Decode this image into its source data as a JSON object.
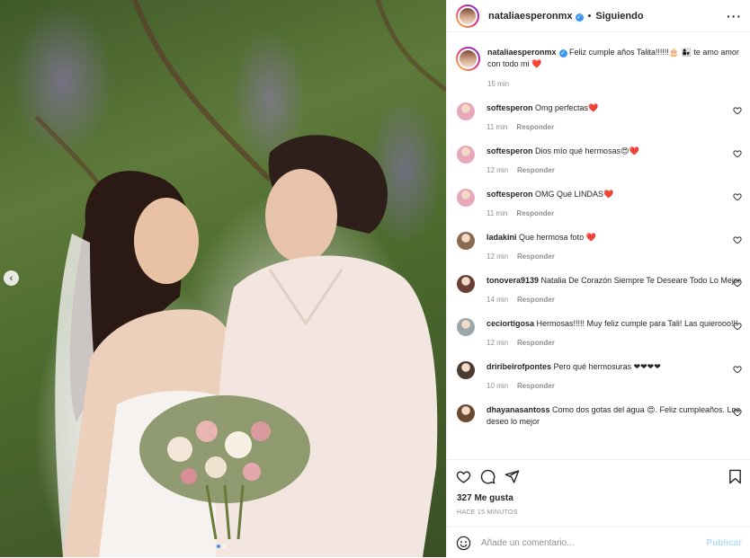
{
  "post": {
    "author": "nataliaesperonmx",
    "follow_label": "Siguiendo",
    "more_label": "···",
    "caption_text": "Feliz cumple años Talita!!!!!!🎂 👩‍👧 te amo amor con todo mi ❤️",
    "caption_time": "15 min",
    "likes": "327 Me gusta",
    "time_ago": "HACE 15 MINUTOS"
  },
  "comments": [
    {
      "user": "softesperon",
      "text": "Omg perfectas❤️",
      "time": "11 min",
      "reply": "Responder",
      "avatar_color": "#e7a9b8"
    },
    {
      "user": "softesperon",
      "text": "Dios mío qué hermosas😍❤️",
      "time": "12 min",
      "reply": "Responder",
      "avatar_color": "#e7a9b8"
    },
    {
      "user": "softesperon",
      "text": "OMG Qué LINDAS❤️",
      "time": "11 min",
      "reply": "Responder",
      "avatar_color": "#e7a9b8"
    },
    {
      "user": "ladakini",
      "text": "Que hermosa foto ❤️",
      "time": "12 min",
      "reply": "Responder",
      "avatar_color": "#8a6a50"
    },
    {
      "user": "tonovera9139",
      "text": "Natalia De Corazón Siempre Te Deseare Todo Lo Mejor",
      "time": "14 min",
      "reply": "Responder",
      "avatar_color": "#6b3e36"
    },
    {
      "user": "ceciortigosa",
      "text": "Hermosas!!!!! Muy feliz cumple para Tali! Las quierooo!!!",
      "time": "12 min",
      "reply": "Responder",
      "avatar_color": "#9aa6a8"
    },
    {
      "user": "driribeirofpontes",
      "text": "Pero qué hermosuras ❤❤❤❤",
      "time": "10 min",
      "reply": "Responder",
      "avatar_color": "#4a3a30"
    },
    {
      "user": "dhayanasantoss",
      "text": "Como dos gotas del água 😍. Feliz cumpleaños. Los deseo lo mejor",
      "time": "",
      "reply": "",
      "avatar_color": "#6a4a30"
    }
  ],
  "add_comment": {
    "placeholder": "Añade un comentario...",
    "publish_label": "Publicar"
  },
  "colors": {
    "accent": "#3897f0",
    "heart": "#ed4956",
    "muted": "#8e8e8e"
  },
  "carousel": {
    "current": 1,
    "total": 2
  }
}
